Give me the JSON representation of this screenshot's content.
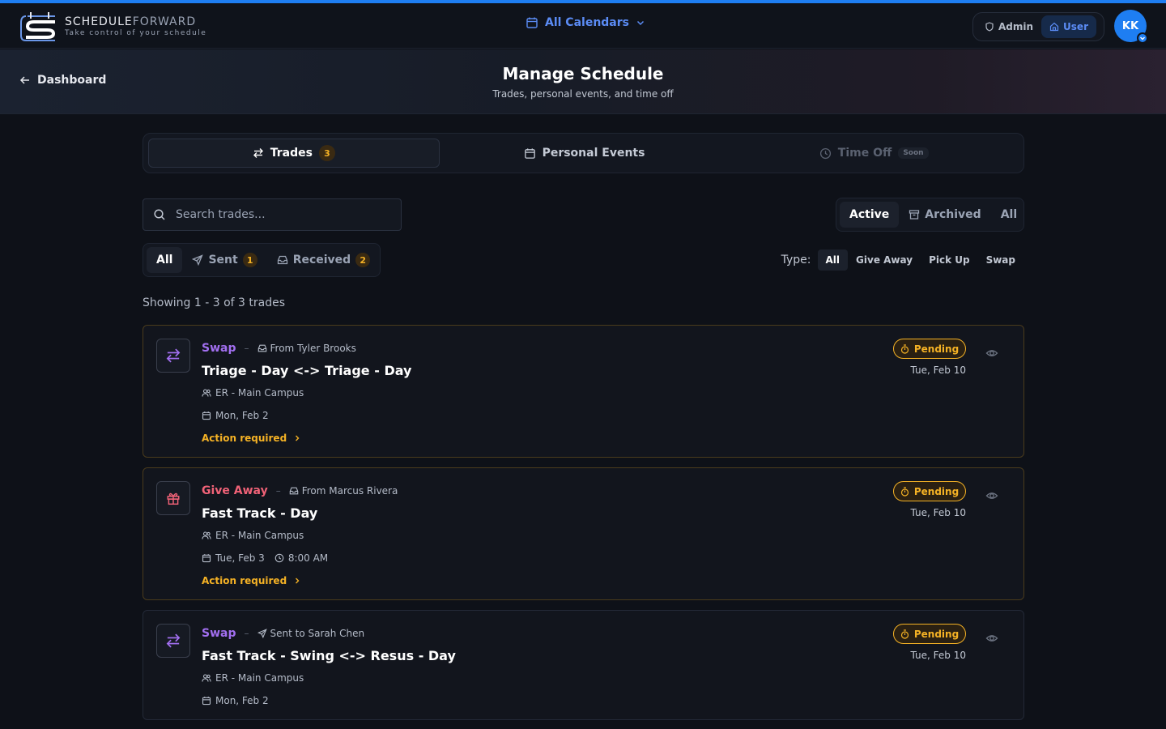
{
  "app": {
    "logo_name_a": "SCHEDULE",
    "logo_name_b": "FORWARD",
    "logo_tagline": "Take control of your schedule"
  },
  "topbar": {
    "calendar_label": "All Calendars",
    "roles": [
      "Admin",
      "User"
    ],
    "active_role": "User",
    "avatar_initials": "KK"
  },
  "header": {
    "back_label": "Dashboard",
    "title": "Manage Schedule",
    "subtitle": "Trades, personal events, and time off"
  },
  "tabs": [
    {
      "label": "Trades",
      "count": "3",
      "active": true
    },
    {
      "label": "Personal Events"
    },
    {
      "label": "Time Off",
      "tag": "Soon",
      "disabled": true
    }
  ],
  "search": {
    "placeholder": "Search trades..."
  },
  "status_filter": {
    "options": [
      "Active",
      "Archived",
      "All"
    ],
    "selected": "Active"
  },
  "direction_filter": {
    "all_label": "All",
    "sent_label": "Sent",
    "sent_count": "1",
    "received_label": "Received",
    "received_count": "2",
    "selected": "All"
  },
  "type_filter": {
    "label": "Type:",
    "options": [
      "All",
      "Give Away",
      "Pick Up",
      "Swap"
    ],
    "selected": "All"
  },
  "showing_text": "Showing 1 - 3 of 3 trades",
  "trades": [
    {
      "type": "Swap",
      "party": "From Tyler Brooks",
      "title": "Triage - Day <-> Triage - Day",
      "location": "ER - Main Campus",
      "date": "Mon, Feb 2",
      "time": "",
      "action": "Action required",
      "status": "Pending",
      "status_date": "Tue, Feb 10"
    },
    {
      "type": "Give Away",
      "party": "From Marcus Rivera",
      "title": "Fast Track - Day",
      "location": "ER - Main Campus",
      "date": "Tue, Feb 3",
      "time": "8:00 AM",
      "action": "Action required",
      "status": "Pending",
      "status_date": "Tue, Feb 10"
    },
    {
      "type": "Swap",
      "party": "Sent to Sarah Chen",
      "title": "Fast Track - Swing <-> Resus - Day",
      "location": "ER - Main Campus",
      "date": "Mon, Feb 2",
      "time": "",
      "action": "",
      "status": "Pending",
      "status_date": "Tue, Feb 10"
    }
  ],
  "colors": {
    "accent_blue": "#1e7ef2",
    "pending_amber": "#f5b225",
    "swap_purple": "#a26ff0",
    "giveaway_red": "#f06277",
    "background": "#0e1118"
  },
  "icons": [
    "calendar-icon",
    "chevron-down-icon",
    "shield-icon",
    "home-icon",
    "arrow-left-icon",
    "swap-arrows-icon",
    "clock-icon",
    "search-icon",
    "archive-icon",
    "send-icon",
    "inbox-icon",
    "users-icon",
    "gift-icon",
    "timer-icon",
    "eye-icon",
    "chevron-right-icon"
  ]
}
